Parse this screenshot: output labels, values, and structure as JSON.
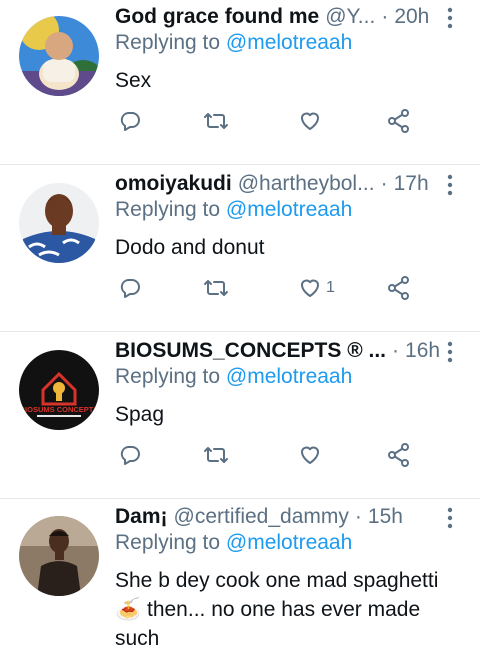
{
  "replying_prefix": "Replying to",
  "tweets": [
    {
      "name": "God grace found me",
      "handle": "@Y...",
      "time": "20h",
      "mention": "@melotreaah",
      "lines": [
        "Sex"
      ],
      "like_count": ""
    },
    {
      "name": "omoiyakudi",
      "handle": "@hartheybol...",
      "time": "17h",
      "mention": "@melotreaah",
      "lines": [
        "Dodo and donut"
      ],
      "like_count": "1"
    },
    {
      "name": "BIOSUMS_CONCEPTS ® ...",
      "handle": "",
      "time": "16h",
      "mention": "@melotreaah",
      "lines": [
        "Spag"
      ],
      "like_count": "",
      "avatar_logo_text": "BIOSUMS CONCEPTS"
    },
    {
      "name": "Dam¡",
      "handle": "@certified_dammy",
      "time": "15h",
      "mention": "@melotreaah",
      "lines": [
        "She b dey cook one mad spaghetti",
        "🍝 then... no one has ever made",
        "such"
      ],
      "like_count": ""
    }
  ],
  "colors": {
    "link": "#1d9bf0",
    "secondary": "#5b7083",
    "divider": "#e3e7ea"
  }
}
